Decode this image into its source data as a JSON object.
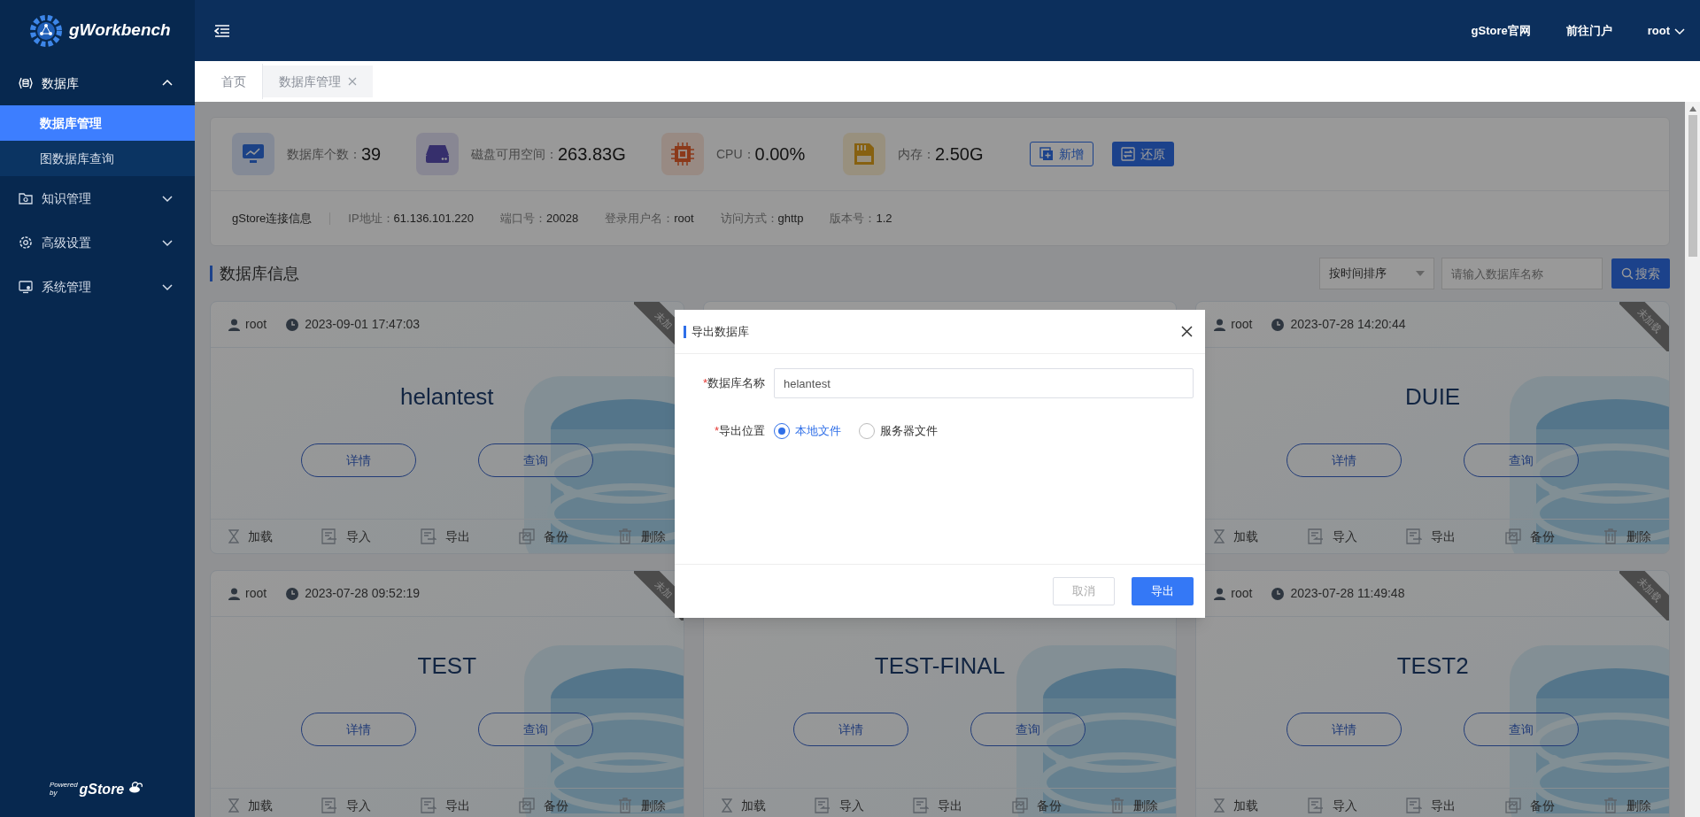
{
  "header": {
    "logo": "gWorkbench",
    "links": [
      "gStore官网",
      "前往门户"
    ],
    "user": "root"
  },
  "sidebar": {
    "items": [
      {
        "kind": "database",
        "label": "数据库",
        "expanded": true,
        "children": [
          {
            "label": "数据库管理",
            "selected": true
          },
          {
            "label": "图数据库查询",
            "selected": false
          }
        ]
      },
      {
        "kind": "knowledge",
        "label": "知识管理",
        "expanded": false
      },
      {
        "kind": "settings",
        "label": "高级设置",
        "expanded": false
      },
      {
        "kind": "system",
        "label": "系统管理",
        "expanded": false
      }
    ],
    "footer": {
      "powered": "Powered",
      "by": "by",
      "brand": "gStore"
    }
  },
  "tabs": [
    {
      "label": "首页",
      "selected": false,
      "closable": false
    },
    {
      "label": "数据库管理",
      "selected": true,
      "closable": true
    }
  ],
  "stats": [
    {
      "kind": "monitor",
      "label": "数据库个数：",
      "value": "39"
    },
    {
      "kind": "disk",
      "label": "磁盘可用空间：",
      "value": "263.83G"
    },
    {
      "kind": "cpu",
      "label": "CPU：",
      "value": "0.00%"
    },
    {
      "kind": "memory",
      "label": "内存：",
      "value": "2.50G"
    }
  ],
  "actions": [
    {
      "kind": "add",
      "label": "新增"
    },
    {
      "kind": "restore",
      "label": "还原"
    }
  ],
  "connection": {
    "title": "gStore连接信息",
    "fields": [
      {
        "label": "IP地址：",
        "value": "61.136.101.220"
      },
      {
        "label": "端口号：",
        "value": "20028"
      },
      {
        "label": "登录用户名：",
        "value": "root"
      },
      {
        "label": "访问方式：",
        "value": "ghttp"
      },
      {
        "label": "版本号：",
        "value": "1.2"
      }
    ]
  },
  "section": {
    "title": "数据库信息",
    "sort": "按时间排序",
    "search_placeholder": "请输入数据库名称",
    "search_button": "搜索"
  },
  "cards": [
    {
      "kind": "database",
      "user": "root",
      "time": "2023-09-01 17:47:03",
      "status": "未加",
      "name": "helantest",
      "buttons": [
        "详情",
        "查询"
      ],
      "actions": [
        {
          "kind": "load",
          "label": "加载"
        },
        {
          "kind": "import",
          "label": "导入"
        },
        {
          "kind": "export",
          "label": "导出"
        },
        {
          "kind": "backup",
          "label": "备份"
        },
        {
          "kind": "delete",
          "label": "删除"
        }
      ]
    },
    {
      "kind": "covered"
    },
    {
      "kind": "database",
      "user": "root",
      "time": "2023-07-28 14:20:44",
      "status": "未加载",
      "name": "DUIE",
      "buttons": [
        "详情",
        "查询"
      ],
      "actions": [
        {
          "kind": "load",
          "label": "加载"
        },
        {
          "kind": "import",
          "label": "导入"
        },
        {
          "kind": "export",
          "label": "导出"
        },
        {
          "kind": "backup",
          "label": "备份"
        },
        {
          "kind": "delete",
          "label": "删除"
        }
      ]
    },
    {
      "kind": "database",
      "user": "root",
      "time": "2023-07-28 09:52:19",
      "status": "未加",
      "name": "TEST",
      "buttons": [
        "详情",
        "查询"
      ],
      "actions": [
        {
          "kind": "load",
          "label": "加载"
        },
        {
          "kind": "import",
          "label": "导入"
        },
        {
          "kind": "export",
          "label": "导出"
        },
        {
          "kind": "backup",
          "label": "备份"
        },
        {
          "kind": "delete",
          "label": "删除"
        }
      ]
    },
    {
      "kind": "database",
      "name": "TEST-FINAL",
      "buttons": [
        "详情",
        "查询"
      ],
      "actions": [
        {
          "kind": "load",
          "label": "加载"
        },
        {
          "kind": "import",
          "label": "导入"
        },
        {
          "kind": "export",
          "label": "导出"
        },
        {
          "kind": "backup",
          "label": "备份"
        },
        {
          "kind": "delete",
          "label": "删除"
        }
      ]
    },
    {
      "kind": "database",
      "user": "root",
      "time": "2023-07-28 11:49:48",
      "status": "未加载",
      "name": "TEST2",
      "buttons": [
        "详情",
        "查询"
      ],
      "actions": [
        {
          "kind": "load",
          "label": "加载"
        },
        {
          "kind": "import",
          "label": "导入"
        },
        {
          "kind": "export",
          "label": "导出"
        },
        {
          "kind": "backup",
          "label": "备份"
        },
        {
          "kind": "delete",
          "label": "删除"
        }
      ]
    }
  ],
  "dialog": {
    "title": "导出数据库",
    "fields": [
      {
        "kind": "text",
        "asterisk": "*",
        "label": "数据库名称",
        "value": "helantest"
      },
      {
        "kind": "radio",
        "asterisk": "*",
        "label": "导出位置",
        "options": [
          {
            "label": "本地文件",
            "selected": true
          },
          {
            "label": "服务器文件",
            "selected": false
          }
        ]
      }
    ],
    "buttons": [
      {
        "kind": "default",
        "label": "取消"
      },
      {
        "kind": "primary",
        "label": "导出"
      }
    ]
  }
}
